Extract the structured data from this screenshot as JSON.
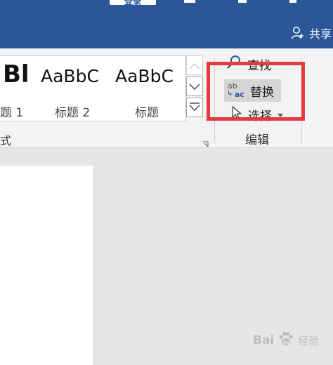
{
  "titlebar": {
    "login_tab": "登录",
    "share_label": "共享"
  },
  "styles_gallery": {
    "items": [
      {
        "sample": "Bl",
        "label": "题 1"
      },
      {
        "sample": "AaBbC",
        "label": "标题 2"
      },
      {
        "sample": "AaBbC",
        "label": "标题"
      }
    ],
    "group_label": "式"
  },
  "editing": {
    "find_label": "查找",
    "replace_label": "替换",
    "replace_icon_top": "ab",
    "replace_icon_bottom": "ac",
    "select_label": "选择",
    "group_label": "编辑"
  },
  "watermark": {
    "brand": "Bai",
    "brand_suffix": "经验",
    "paw": "du"
  },
  "colors": {
    "titlebar": "#2b579a",
    "highlight": "#e63a3f",
    "ribbon": "#f3f3f3",
    "canvas": "#e6e6e6"
  }
}
